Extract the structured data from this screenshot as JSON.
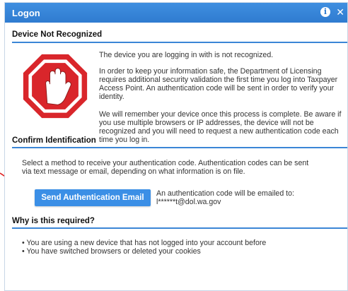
{
  "dialog": {
    "title": "Logon"
  },
  "device": {
    "heading": "Device Not Recognized",
    "p1": "The device you are logging in with is not recognized.",
    "p2_lines": [
      "In order to keep your information safe, the Department of Licensing",
      "requires additional security validation the first time you log into Taxpayer",
      "Access Point. An authentication code will be sent in order to verify your",
      "identity."
    ],
    "p3_lines": [
      "We will remember your device once this process is complete. Be aware if",
      "you use multiple browsers or IP addresses, the device will not be",
      "recognized and you will need to request a new authentication code each",
      "time you log in."
    ]
  },
  "confirm": {
    "heading": "Confirm Identification",
    "instructions_lines": [
      "Select a method to receive your authentication code. Authentication codes can be sent",
      "via text message or email, depending on what information is on file."
    ],
    "button_label": "Send Authentication Email",
    "email_note": "An authentication code will be emailed to:",
    "email_masked": "l******t@dol.wa.gov"
  },
  "why": {
    "heading": "Why is this required?",
    "bullets": [
      "• You are using a new device that has not logged into your account before",
      "• You have switched browsers or deleted your cookies"
    ]
  },
  "colors": {
    "title_bar": "#2f7bd0",
    "button": "#3b8fe6",
    "rule": "#3b86d6",
    "stop_red": "#d9262b",
    "arrow": "#e02020"
  },
  "icons": [
    "info-icon",
    "close-icon",
    "stop-hand-icon",
    "pointer-arrow-icon"
  ]
}
